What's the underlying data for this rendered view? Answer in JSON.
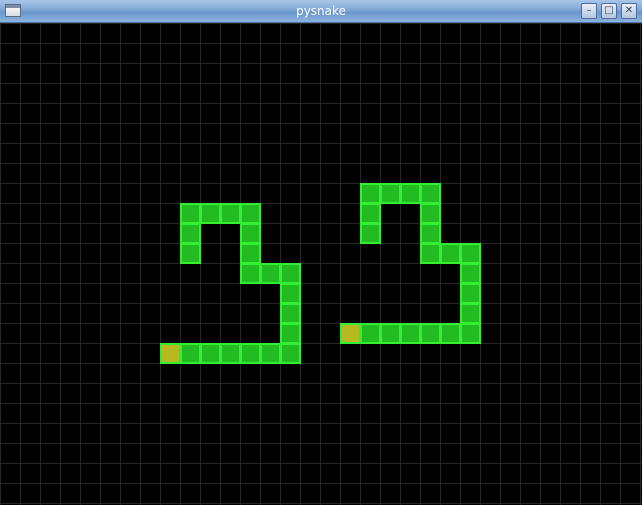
{
  "window": {
    "title": "pysnake",
    "buttons": {
      "minimize_glyph": "–",
      "maximize_glyph": "□",
      "close_glyph": "✕"
    }
  },
  "game": {
    "colors": {
      "background": "#000000",
      "grid_line": "#262626",
      "snake_body_fill": "#22bb22",
      "snake_border": "#33ee33",
      "snake_head_fill": "#b8b820"
    },
    "snakes": [
      {
        "head": [
          8,
          16
        ],
        "body": [
          [
            8,
            16
          ],
          [
            9,
            16
          ],
          [
            10,
            16
          ],
          [
            11,
            16
          ],
          [
            12,
            16
          ],
          [
            13,
            16
          ],
          [
            14,
            16
          ],
          [
            14,
            15
          ],
          [
            14,
            14
          ],
          [
            14,
            13
          ],
          [
            14,
            12
          ],
          [
            13,
            12
          ],
          [
            12,
            12
          ],
          [
            12,
            11
          ],
          [
            12,
            10
          ],
          [
            12,
            9
          ],
          [
            11,
            9
          ],
          [
            10,
            9
          ],
          [
            9,
            9
          ],
          [
            9,
            10
          ],
          [
            9,
            11
          ]
        ]
      },
      {
        "head": [
          17,
          15
        ],
        "body": [
          [
            17,
            15
          ],
          [
            18,
            15
          ],
          [
            19,
            15
          ],
          [
            20,
            15
          ],
          [
            21,
            15
          ],
          [
            22,
            15
          ],
          [
            23,
            15
          ],
          [
            23,
            14
          ],
          [
            23,
            13
          ],
          [
            23,
            12
          ],
          [
            23,
            11
          ],
          [
            22,
            11
          ],
          [
            21,
            11
          ],
          [
            21,
            10
          ],
          [
            21,
            9
          ],
          [
            21,
            8
          ],
          [
            20,
            8
          ],
          [
            19,
            8
          ],
          [
            18,
            8
          ],
          [
            18,
            9
          ],
          [
            18,
            10
          ]
        ]
      }
    ]
  }
}
